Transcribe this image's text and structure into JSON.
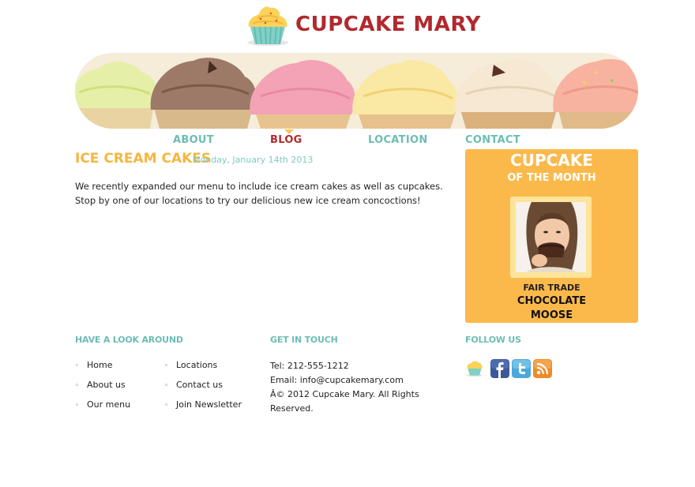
{
  "brand": {
    "name": "CUPCAKE MARY",
    "accent": "#b0292e",
    "teal": "#6cbdb4",
    "orange": "#fbb94c"
  },
  "nav": {
    "items": [
      {
        "label": "ABOUT",
        "active": false
      },
      {
        "label": "BLOG",
        "active": true
      },
      {
        "label": "LOCATION",
        "active": false
      },
      {
        "label": "CONTACT",
        "active": false
      }
    ]
  },
  "post": {
    "title": "ICE CREAM CAKES",
    "date": "Monday, January 14th 2013",
    "body": "We recently expanded our menu to include ice cream cakes as well as cupcakes. Stop by one of our locations to try our delicious new ice cream concoctions!"
  },
  "feature": {
    "title": "CUPCAKE",
    "subtitle": "OF THE MONTH",
    "tag": "FAIR TRADE",
    "name_line1": "CHOCOLATE",
    "name_line2": "MOOSE"
  },
  "footer": {
    "look_heading": "HAVE A LOOK AROUND",
    "links_col1": [
      "Home",
      "About us",
      "Our menu"
    ],
    "links_col2": [
      "Locations",
      "Contact us",
      "Join Newsletter"
    ],
    "contact_heading": "GET IN TOUCH",
    "tel": "Tel: 212-555-1212",
    "email": "Email: info@cupcakemary.com",
    "copyright": "Â© 2012 Cupcake Mary. All Rights Reserved.",
    "follow_heading": "FOLLOW US",
    "social": [
      {
        "icon": "cupcake-icon"
      },
      {
        "icon": "facebook-icon"
      },
      {
        "icon": "twitter-icon"
      },
      {
        "icon": "rss-icon"
      }
    ]
  }
}
